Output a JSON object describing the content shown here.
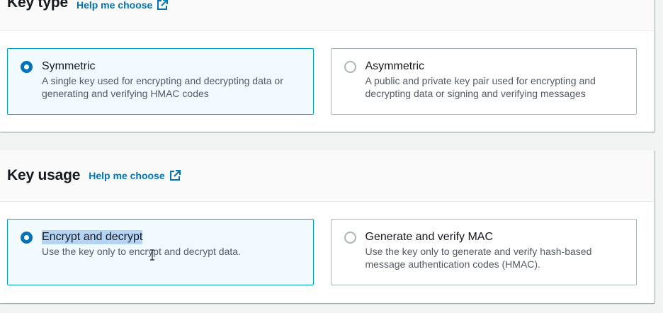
{
  "key_type": {
    "title": "Key type",
    "help_link": "Help me choose",
    "options": [
      {
        "label": "Symmetric",
        "description": "A single key used for encrypting and decrypting data or generating and verifying HMAC codes",
        "selected": true
      },
      {
        "label": "Asymmetric",
        "description": "A public and private key pair used for encrypting and decrypting data or signing and verifying messages",
        "selected": false
      }
    ]
  },
  "key_usage": {
    "title": "Key usage",
    "help_link": "Help me choose",
    "options": [
      {
        "label": "Encrypt and decrypt",
        "description": "Use the key only to encrypt and decrypt data.",
        "selected": true
      },
      {
        "label": "Generate and verify MAC",
        "description": "Use the key only to generate and verify hash-based message authentication codes (HMAC).",
        "selected": false
      }
    ]
  },
  "colors": {
    "link": "#0073bb",
    "selected_border": "#00a1c9",
    "selected_bg": "#f1faff",
    "text_highlight": "#b3d4f5"
  },
  "icons": [
    "external-link-icon",
    "radio-selected-icon",
    "radio-unselected-icon",
    "text-cursor-icon"
  ]
}
